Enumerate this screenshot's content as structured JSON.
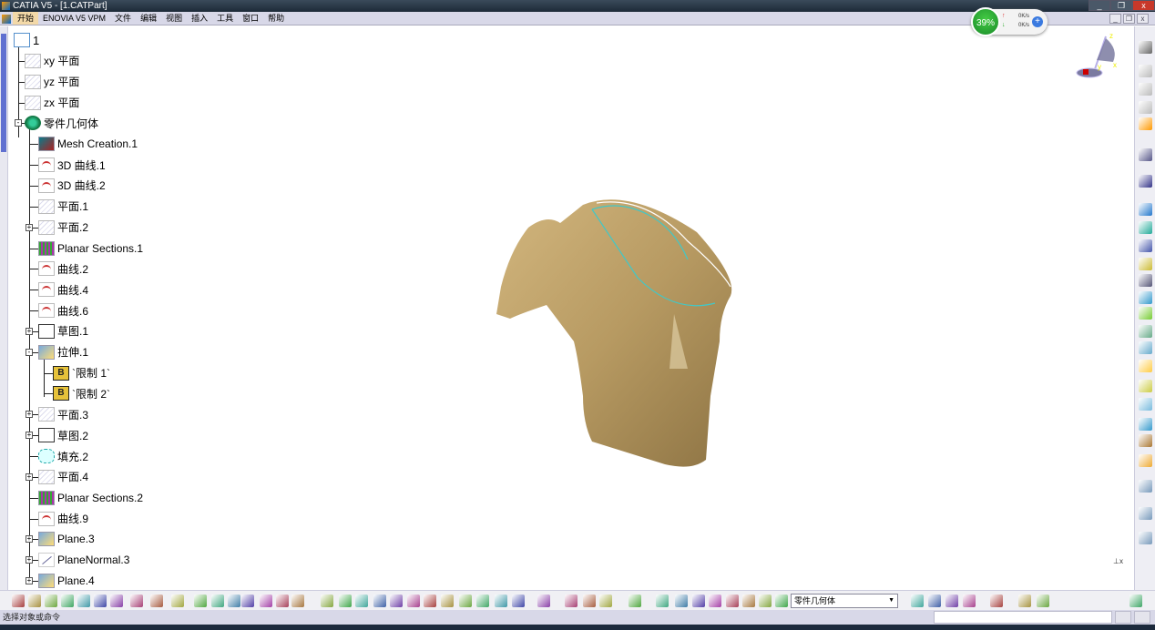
{
  "window": {
    "title": "CATIA V5 - [1.CATPart]",
    "minimize": "_",
    "restore": "❐",
    "close": "x"
  },
  "menu": [
    "开始",
    "ENOVIA V5 VPM",
    "文件",
    "编辑",
    "视图",
    "插入",
    "工具",
    "窗口",
    "帮助"
  ],
  "mdi": {
    "minimize": "_",
    "restore": "❐",
    "close": "x"
  },
  "net_widget": {
    "percent": "39%",
    "up": "0K/s",
    "down": "0K/s",
    "up_arrow": "↑",
    "down_arrow": "↓",
    "plus": "+"
  },
  "compass": {
    "z": "z",
    "x": "x",
    "y": "y"
  },
  "tree": [
    {
      "label": "1",
      "level": 0,
      "icon": "part-root-icon",
      "cls": "root"
    },
    {
      "label": "xy 平面",
      "level": 1,
      "icon": "plane-icon",
      "cls": "plane"
    },
    {
      "label": "yz 平面",
      "level": 1,
      "icon": "plane-icon",
      "cls": "plane"
    },
    {
      "label": "zx 平面",
      "level": 1,
      "icon": "plane-icon",
      "cls": "plane"
    },
    {
      "label": "零件几何体",
      "level": 1,
      "icon": "part-body-icon",
      "cls": "body",
      "exp": "-"
    },
    {
      "label": "Mesh Creation.1",
      "level": 2,
      "icon": "mesh-icon",
      "cls": "mesh"
    },
    {
      "label": "3D 曲线.1",
      "level": 2,
      "icon": "curve-icon",
      "cls": "curve"
    },
    {
      "label": "3D 曲线.2",
      "level": 2,
      "icon": "curve-icon",
      "cls": "curve"
    },
    {
      "label": "平面.1",
      "level": 2,
      "icon": "plane-icon",
      "cls": "plane"
    },
    {
      "label": "平面.2",
      "level": 2,
      "icon": "plane-icon",
      "cls": "plane",
      "exp": "+"
    },
    {
      "label": "Planar Sections.1",
      "level": 2,
      "icon": "planar-sections-icon",
      "cls": "sect"
    },
    {
      "label": "曲线.2",
      "level": 2,
      "icon": "curve-icon",
      "cls": "curve"
    },
    {
      "label": "曲线.4",
      "level": 2,
      "icon": "curve-icon",
      "cls": "curve"
    },
    {
      "label": "曲线.6",
      "level": 2,
      "icon": "curve-icon",
      "cls": "curve"
    },
    {
      "label": "草图.1",
      "level": 2,
      "icon": "sketch-icon",
      "cls": "sketch",
      "exp": "+"
    },
    {
      "label": "拉伸.1",
      "level": 2,
      "icon": "extrude-icon",
      "cls": "extr",
      "exp": "-"
    },
    {
      "label": "`限制 1`",
      "level": 3,
      "icon": "limit-icon",
      "cls": "limit"
    },
    {
      "label": "`限制 2`",
      "level": 3,
      "icon": "limit-icon",
      "cls": "limit"
    },
    {
      "label": "平面.3",
      "level": 2,
      "icon": "plane-icon",
      "cls": "plane",
      "exp": "+"
    },
    {
      "label": "草图.2",
      "level": 2,
      "icon": "sketch-icon",
      "cls": "sketch",
      "exp": "+"
    },
    {
      "label": "填充.2",
      "level": 2,
      "icon": "fill-icon",
      "cls": "fill"
    },
    {
      "label": "平面.4",
      "level": 2,
      "icon": "plane-icon",
      "cls": "plane",
      "exp": "+"
    },
    {
      "label": "Planar Sections.2",
      "level": 2,
      "icon": "planar-sections-icon",
      "cls": "sect"
    },
    {
      "label": "曲线.9",
      "level": 2,
      "icon": "curve-icon",
      "cls": "curve"
    },
    {
      "label": "Plane.3",
      "level": 2,
      "icon": "plane-icon",
      "cls": "extr",
      "exp": "+"
    },
    {
      "label": "PlaneNormal.3",
      "level": 2,
      "icon": "plane-normal-icon",
      "cls": "pn",
      "exp": "+"
    },
    {
      "label": "Plane.4",
      "level": 2,
      "icon": "plane-icon",
      "cls": "extr",
      "exp": "+"
    }
  ],
  "toolbar": {
    "current_body": "零件几何体",
    "limit_letter": "B"
  },
  "status": {
    "prompt": "选择对象或命令"
  },
  "axis_label": "x",
  "colors": {
    "model": "#b79a62",
    "accent": "#6070d0"
  }
}
